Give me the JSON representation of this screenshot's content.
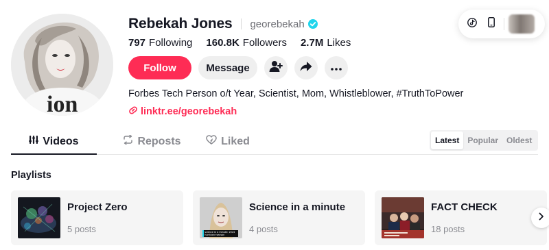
{
  "profile": {
    "display_name": "Rebekah Jones",
    "username": "georebekah",
    "verified": true,
    "stats": [
      {
        "value": "797",
        "label": "Following"
      },
      {
        "value": "160.8K",
        "label": "Followers"
      },
      {
        "value": "2.7M",
        "label": "Likes"
      }
    ],
    "bio": "Forbes Tech Person o/t Year, Scientist, Mom, Whistleblower, #TruthToPower",
    "link": "linktr.ee/georebekah",
    "avatar_text": "ion"
  },
  "actions": {
    "follow_label": "Follow",
    "message_label": "Message",
    "icons": [
      "add-user-icon",
      "share-icon",
      "more-icon"
    ]
  },
  "corner_controls": {
    "icons": [
      "tiktok-icon",
      "mobile-icon"
    ]
  },
  "tabs": [
    {
      "label": "Videos",
      "icon": "grid-icon",
      "active": true
    },
    {
      "label": "Reposts",
      "icon": "repost-icon",
      "active": false
    },
    {
      "label": "Liked",
      "icon": "heart-icon",
      "active": false
    }
  ],
  "sort_options": [
    {
      "label": "Latest",
      "active": true
    },
    {
      "label": "Popular",
      "active": false
    },
    {
      "label": "Oldest",
      "active": false
    }
  ],
  "playlists": {
    "title": "Playlists",
    "items": [
      {
        "title": "Project Zero",
        "count": "5 posts"
      },
      {
        "title": "Science in a minute",
        "count": "4 posts",
        "thumb_caption": "science in a minute: 2024 hurricane season"
      },
      {
        "title": "FACT CHECK",
        "count": "18 posts"
      }
    ]
  },
  "colors": {
    "accent": "#fe2c55",
    "verified": "#20d5ec",
    "text": "#161823",
    "muted": "#8a8b91"
  }
}
